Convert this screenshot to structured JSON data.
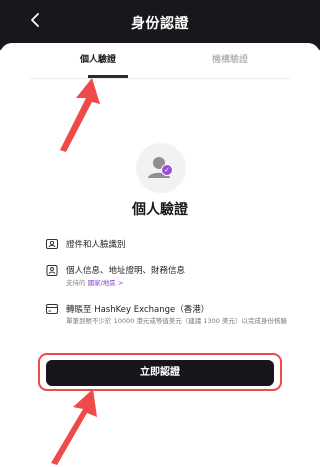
{
  "header": {
    "title": "身份認證",
    "back_icon": "chevron-left-icon"
  },
  "tabs": [
    {
      "label": "個人驗證",
      "active": true
    },
    {
      "label": "機構驗證",
      "active": false
    }
  ],
  "verification": {
    "heading": "個人驗證",
    "steps": [
      {
        "icon": "id-card-icon",
        "label": "證件和人臉識別"
      },
      {
        "icon": "document-person-icon",
        "label": "個人信息、地址證明、財務信息",
        "sub_prefix": "支持的",
        "sub_link": "國家/地區 >"
      },
      {
        "icon": "card-icon",
        "label": "轉賬至 HashKey Exchange（香港）",
        "desc": "單筆到賬不少於 10000 港元或等值美元（建議 1300 美元）以完成身份核驗"
      }
    ],
    "cta_label": "立即認證"
  },
  "colors": {
    "header_bg": "#17171c",
    "accent": "#9b4ad9",
    "annotation_red": "#ef4a4a"
  }
}
